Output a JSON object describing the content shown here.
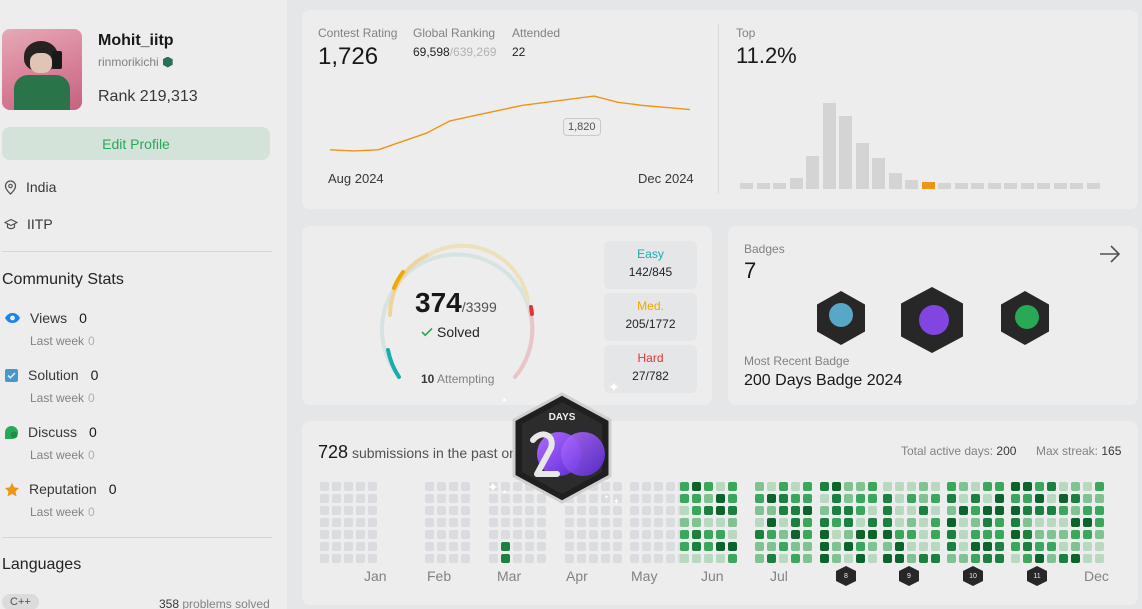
{
  "profile": {
    "username": "Mohit_iitp",
    "handle": "rinmorikichi",
    "rank_label": "Rank 219,313",
    "edit_button": "Edit Profile",
    "location": "India",
    "school": "IITP"
  },
  "community_stats": {
    "title": "Community Stats",
    "items": [
      {
        "label": "Views",
        "value": "0",
        "sub_label": "Last week",
        "sub_value": "0",
        "icon": "eye-icon",
        "color": "#1a90ff"
      },
      {
        "label": "Solution",
        "value": "0",
        "sub_label": "Last week",
        "sub_value": "0",
        "icon": "solution-icon",
        "color": "#4aa3df"
      },
      {
        "label": "Discuss",
        "value": "0",
        "sub_label": "Last week",
        "sub_value": "0",
        "icon": "discuss-icon",
        "color": "#2db55d"
      },
      {
        "label": "Reputation",
        "value": "0",
        "sub_label": "Last week",
        "sub_value": "0",
        "icon": "star-icon",
        "color": "#ffa116"
      }
    ]
  },
  "languages": {
    "title": "Languages",
    "items": [
      {
        "name": "C++",
        "count": "358",
        "suffix": "problems solved"
      }
    ]
  },
  "contest": {
    "rating_label": "Contest Rating",
    "rating_value": "1,726",
    "global_label": "Global Ranking",
    "global_value": "69,598",
    "global_total": "/639,269",
    "attended_label": "Attended",
    "attended_value": "22",
    "tooltip": "1,820",
    "start_label": "Aug 2024",
    "end_label": "Dec 2024",
    "top_label": "Top",
    "top_value": "11.2%",
    "rating_series": [
      1560,
      1555,
      1560,
      1600,
      1640,
      1700,
      1725,
      1750,
      1775,
      1790,
      1805,
      1820,
      1790,
      1775,
      1765,
      1755
    ],
    "distribution": [
      3,
      3,
      3,
      6,
      18,
      47,
      40,
      25,
      17,
      9,
      5,
      4,
      2,
      2,
      2,
      2,
      2,
      2,
      2,
      2,
      2,
      2
    ],
    "highlight_index": 11
  },
  "solved": {
    "solved_value": "374",
    "total": "/3399",
    "solved_label": "Solved",
    "attempting_value": "10",
    "attempting_label": "Attempting",
    "difficulties": [
      {
        "name": "Easy",
        "value": "142/845",
        "color": "#1cbaba"
      },
      {
        "name": "Med.",
        "value": "205/1772",
        "color": "#ffb700"
      },
      {
        "name": "Hard",
        "value": "27/782",
        "color": "#f63737"
      }
    ]
  },
  "badges": {
    "title": "Badges",
    "count": "7",
    "recent_label": "Most Recent Badge",
    "recent_value": "200 Days Badge 2024",
    "popup_text": "DAYS"
  },
  "submissions": {
    "count": "728",
    "suffix": "submissions in the past one year",
    "active_label": "Total active days:",
    "active_value": "200",
    "streak_label": "Max streak:",
    "streak_value": "165",
    "months": [
      "Jan",
      "Feb",
      "Mar",
      "Apr",
      "May",
      "Jun",
      "Jul",
      "Dec"
    ],
    "month_badges": [
      "8",
      "9",
      "10",
      "11"
    ]
  }
}
